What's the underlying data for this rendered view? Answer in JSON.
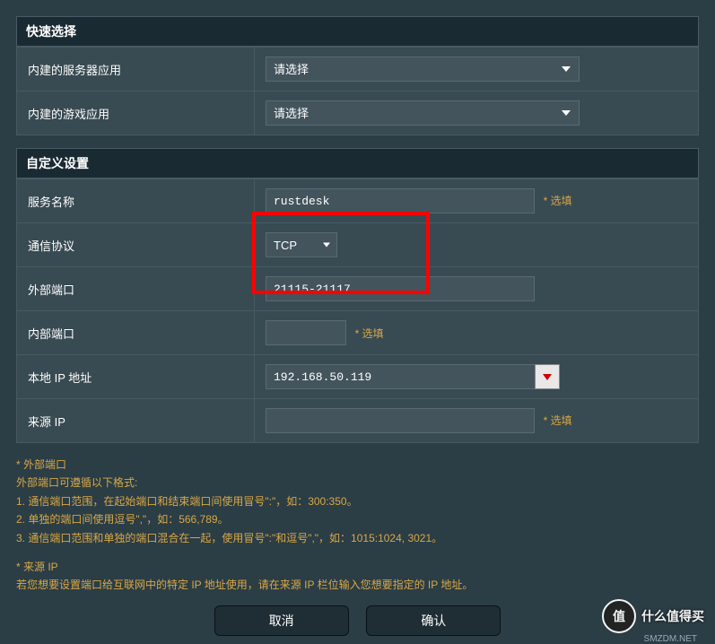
{
  "quick_select": {
    "header": "快速选择",
    "server_app_label": "内建的服务器应用",
    "server_app_value": "请选择",
    "game_app_label": "内建的游戏应用",
    "game_app_value": "请选择"
  },
  "custom": {
    "header": "自定义设置",
    "service_name_label": "服务名称",
    "service_name_value": "rustdesk",
    "protocol_label": "通信协议",
    "protocol_value": "TCP",
    "external_port_label": "外部端口",
    "external_port_value": "21115-21117",
    "internal_port_label": "内部端口",
    "internal_port_value": "",
    "local_ip_label": "本地 IP 地址",
    "local_ip_value": "192.168.50.119",
    "source_ip_label": "来源 IP",
    "source_ip_value": "",
    "optional_text": "* 选填"
  },
  "help": {
    "ext_title": "* 外部端口",
    "ext_line0": "外部端口可遵循以下格式:",
    "ext_line1": "1. 通信端口范围，在起始端口和结束端口间使用冒号\":\"，如：300:350。",
    "ext_line2": "2. 单独的端口间使用逗号\",\"，如：566,789。",
    "ext_line3": "3. 通信端口范围和单独的端口混合在一起，使用冒号\":\"和逗号\",\"，如：1015:1024, 3021。",
    "src_title": "* 来源 IP",
    "src_line": "若您想要设置端口给互联网中的特定 IP 地址使用，请在来源 IP 栏位输入您想要指定的 IP 地址。"
  },
  "buttons": {
    "cancel": "取消",
    "confirm": "确认"
  },
  "watermark": {
    "badge": "值",
    "text": "什么值得买",
    "sub": "SMZDM.NET"
  }
}
